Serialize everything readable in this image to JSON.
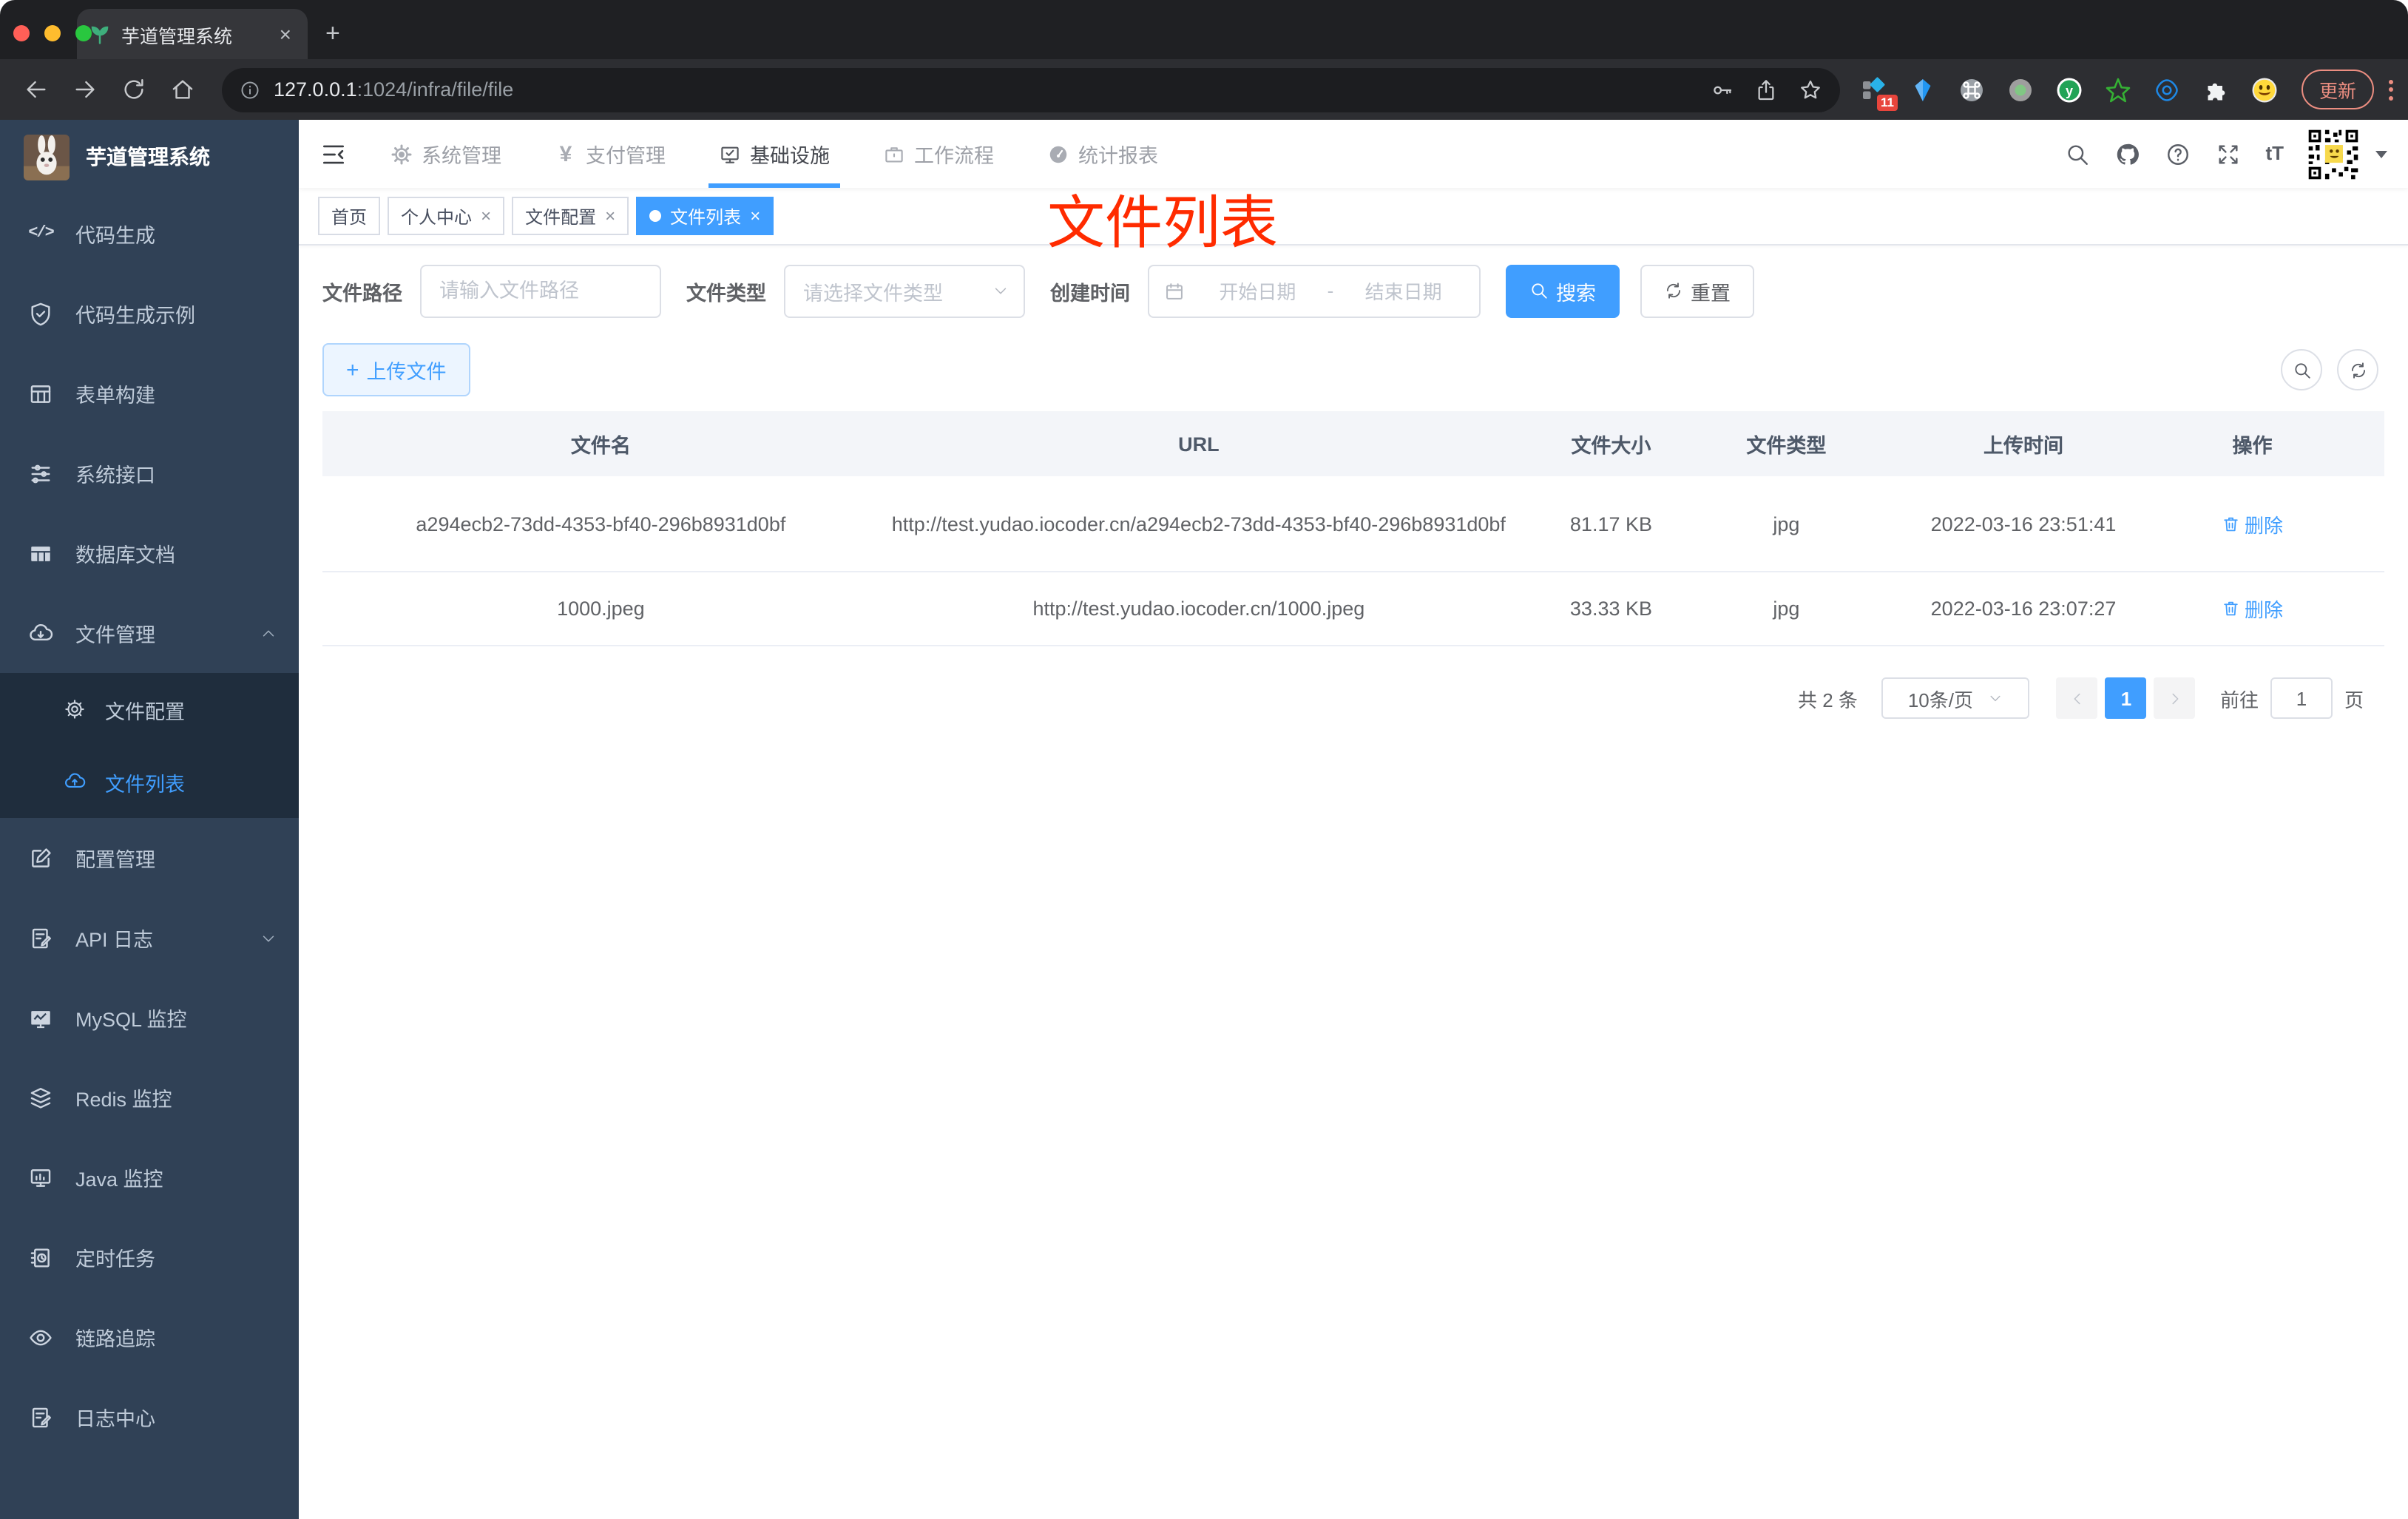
{
  "browser": {
    "tab_title": "芋道管理系统",
    "url_host": "127.0.0.1",
    "url_path": ":1024/infra/file/file",
    "update_label": "更新",
    "extension_badge": "11"
  },
  "ui": {
    "close_glyph": "×",
    "plus_glyph": "+",
    "newtab_glyph": "+",
    "code_glyph": "</>",
    "yen_glyph": "¥",
    "font_size_glyph": "tT",
    "question_glyph": "?",
    "y_glyph": "y"
  },
  "header": {
    "nav": [
      {
        "label": "系统管理"
      },
      {
        "label": "支付管理"
      },
      {
        "label": "基础设施"
      },
      {
        "label": "工作流程"
      },
      {
        "label": "统计报表"
      }
    ]
  },
  "sidebar": {
    "title": "芋道管理系统",
    "items": [
      {
        "label": "代码生成"
      },
      {
        "label": "代码生成示例"
      },
      {
        "label": "表单构建"
      },
      {
        "label": "系统接口"
      },
      {
        "label": "数据库文档"
      },
      {
        "label": "文件管理",
        "expanded": true,
        "children": [
          {
            "label": "文件配置"
          },
          {
            "label": "文件列表",
            "active": true
          }
        ]
      },
      {
        "label": "配置管理"
      },
      {
        "label": "API 日志"
      },
      {
        "label": "MySQL 监控"
      },
      {
        "label": "Redis 监控"
      },
      {
        "label": "Java 监控"
      },
      {
        "label": "定时任务"
      },
      {
        "label": "链路追踪"
      },
      {
        "label": "日志中心"
      }
    ]
  },
  "tabs": [
    {
      "label": "首页"
    },
    {
      "label": "个人中心",
      "closable": true
    },
    {
      "label": "文件配置",
      "closable": true
    },
    {
      "label": "文件列表",
      "closable": true,
      "active": true
    }
  ],
  "annotation": {
    "text": "文件列表",
    "color": "#ff2b00"
  },
  "filters": {
    "path_label": "文件路径",
    "path_placeholder": "请输入文件路径",
    "type_label": "文件类型",
    "type_placeholder": "请选择文件类型",
    "date_label": "创建时间",
    "date_start_placeholder": "开始日期",
    "date_separator": "-",
    "date_end_placeholder": "结束日期",
    "search_label": "搜索",
    "reset_label": "重置"
  },
  "toolbar": {
    "upload_label": "上传文件"
  },
  "table": {
    "headers": [
      "文件名",
      "URL",
      "文件大小",
      "文件类型",
      "上传时间",
      "操作"
    ],
    "rows": [
      {
        "name": "a294ecb2-73dd-4353-bf40-296b8931d0bf",
        "url": "http://test.yudao.iocoder.cn/a294ecb2-73dd-4353-bf40-296b8931d0bf",
        "size": "81.17 KB",
        "type": "jpg",
        "time": "2022-03-16 23:51:41",
        "action": "删除"
      },
      {
        "name": "1000.jpeg",
        "url": "http://test.yudao.iocoder.cn/1000.jpeg",
        "size": "33.33 KB",
        "type": "jpg",
        "time": "2022-03-16 23:07:27",
        "action": "删除"
      }
    ]
  },
  "pagination": {
    "total": "共 2 条",
    "page_size": "10条/页",
    "page": "1",
    "goto_label": "前往",
    "goto_value": "1",
    "page_unit": "页"
  },
  "colors": {
    "accent": "#409eff",
    "sidebar_bg": "#304156",
    "submenu_bg": "#1f2d3d",
    "annotation_red": "#ff2b00",
    "update_pill": "#ec8e81"
  }
}
